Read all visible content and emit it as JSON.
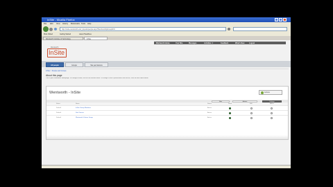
{
  "browser": {
    "title": "InSite - Mozilla Firefox",
    "menu": [
      "File",
      "Edit",
      "View",
      "History",
      "Bookmarks",
      "Tools",
      "Help"
    ],
    "url": "http://insite.wentworth.edu/_layouts/people.aspx?MembershipGroupId=0",
    "bookmarks": [
      "Most Visited",
      "Getting Started",
      "Latest Headlines"
    ],
    "tabs": [
      "Wentworth Institute of Technology",
      "InSite"
    ]
  },
  "site": {
    "logo_small": "Wentworth",
    "logo_main": "InSite",
    "topnav": [
      "Wentworth Home",
      "Your Site",
      "Messages",
      "Activities ▼",
      "Feedback",
      "What's New",
      "Logout"
    ],
    "tabs": [
      "All people",
      "Groups",
      "Site permissions"
    ],
    "breadcrumb": "InSite > People and Groups",
    "about_title": "About this page",
    "about_text": "This is your Wentworth Homepage. To change its look, use the site actions menu. To change a user's permissions and access, click on their name below.",
    "panel_title": "Wentworth - InSite",
    "manage_label": "Actions",
    "toolbar": [
      "New",
      "Actions",
      "Settings"
    ],
    "columns": [
      "Select",
      "Name",
      "Status",
      "Read",
      "Edit",
      "Admin"
    ],
    "rows": [
      {
        "select": "Default",
        "name": "InSite Group Members",
        "status": "Active"
      },
      {
        "select": "Default",
        "name": "Site Owners",
        "status": "Active"
      },
      {
        "select": "Default",
        "name": "Wentworth Visitors Group",
        "status": "Active"
      }
    ]
  }
}
